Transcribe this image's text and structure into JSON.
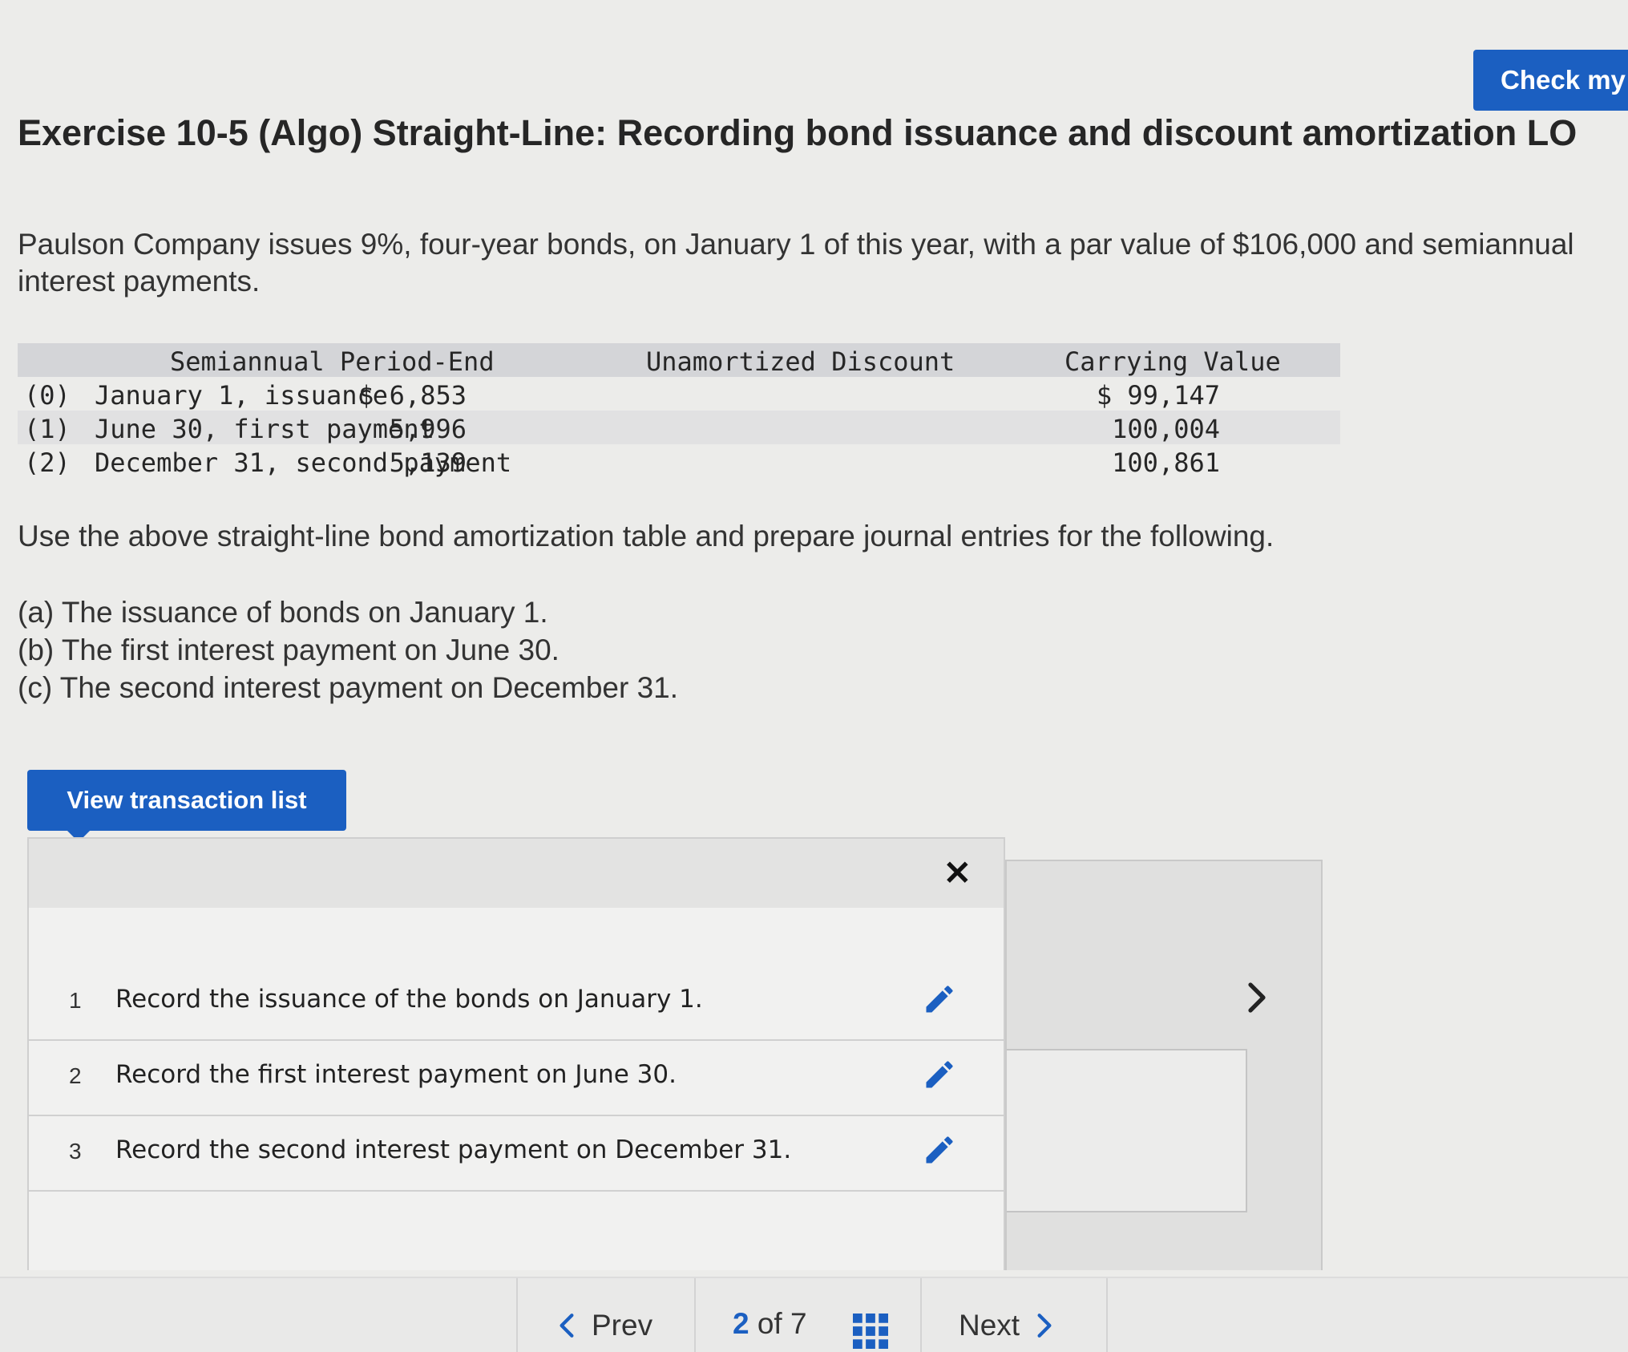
{
  "header": {
    "check_label": "Check my"
  },
  "exercise": {
    "title": "Exercise 10-5 (Algo) Straight-Line: Recording bond issuance and discount amortization LO",
    "intro": "Paulson Company issues 9%, four-year bonds, on January 1 of this year, with a par value of $106,000 and semiannual interest payments."
  },
  "amortization_table": {
    "headers": {
      "period": "Semiannual Period-End",
      "discount": "Unamortized Discount",
      "carrying": "Carrying Value"
    },
    "rows": [
      {
        "idx": "(0)",
        "period": "January 1, issuance",
        "discount": "$ 6,853",
        "carrying": "$ 99,147"
      },
      {
        "idx": "(1)",
        "period": "June 30, first payment",
        "discount": "5,996",
        "carrying": "100,004"
      },
      {
        "idx": "(2)",
        "period": "December 31, second payment",
        "discount": "5,139",
        "carrying": "100,861"
      }
    ]
  },
  "instructions": {
    "text": "Use the above straight-line bond amortization table and prepare journal entries for the following.",
    "items": [
      "(a) The issuance of bonds on January 1.",
      "(b) The first interest payment on June 30.",
      "(c) The second interest payment on December 31."
    ]
  },
  "transaction_list": {
    "button_label": "View transaction list",
    "close_symbol": "✕",
    "items": [
      {
        "num": "1",
        "text": "Record the issuance of the bonds on January 1."
      },
      {
        "num": "2",
        "text": "Record the first interest payment on June 30."
      },
      {
        "num": "3",
        "text": "Record the second interest payment on December 31."
      }
    ]
  },
  "navigation": {
    "prev_label": "Prev",
    "next_label": "Next",
    "current_page": "2",
    "of_label": "of",
    "total_pages": "7"
  },
  "colors": {
    "accent": "#1b5fc1",
    "background": "#ececea"
  }
}
